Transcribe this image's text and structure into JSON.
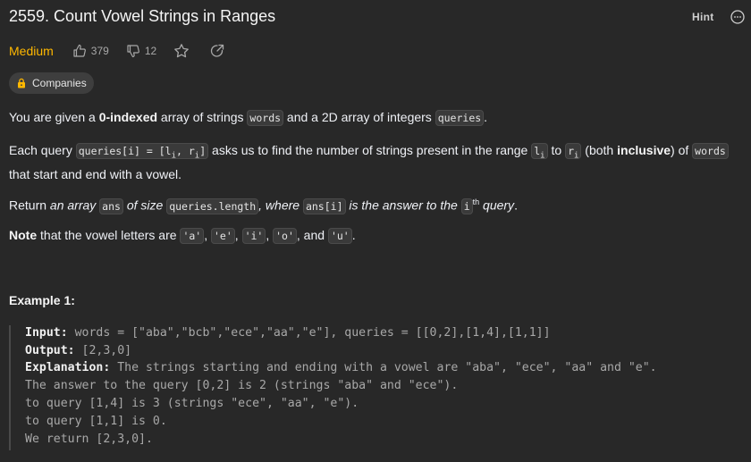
{
  "header": {
    "title": "2559. Count Vowel Strings in Ranges",
    "hint_label": "Hint",
    "more_icon": "more-circle-icon"
  },
  "meta": {
    "difficulty": "Medium",
    "difficulty_color": "#ffb800",
    "likes": "379",
    "dislikes": "12",
    "companies_label": "Companies"
  },
  "description": {
    "p1": {
      "t1": "You are given a ",
      "b1": "0-indexed",
      "t2": " array of strings ",
      "c1": "words",
      "t3": " and a 2D array of integers ",
      "c2": "queries",
      "t4": "."
    },
    "p2": {
      "t1": "Each query ",
      "c1a": "queries[i] = [l",
      "c1s1": "i",
      "c1b": ", r",
      "c1s2": "i",
      "c1c": "]",
      "t2": " asks us to find the number of strings present in the range ",
      "c2a": "l",
      "c2s": "i",
      "t3": " to ",
      "c3a": "r",
      "c3s": "i",
      "t4": " (both ",
      "b1": "inclusive",
      "t5": ") of ",
      "c4": "words",
      "line2": "that start and end with a vowel."
    },
    "p3": {
      "t1": "Return ",
      "i1": "an array ",
      "c1": "ans",
      "i2": " of size ",
      "c2": "queries.length",
      "i3": ", where ",
      "c3": "ans[i]",
      "i4": " is the answer to the ",
      "c4": "i",
      "sup": "th",
      "i5": " query",
      "t2": "."
    },
    "p4": {
      "b1": "Note",
      "t1": " that the vowel letters are ",
      "c1": "'a'",
      "t2": ", ",
      "c2": "'e'",
      "t3": ", ",
      "c3": "'i'",
      "t4": ", ",
      "c4": "'o'",
      "t5": ", and ",
      "c5": "'u'",
      "t6": "."
    }
  },
  "example1": {
    "title": "Example 1:",
    "input_label": "Input:",
    "input_value": " words = [\"aba\",\"bcb\",\"ece\",\"aa\",\"e\"], queries = [[0,2],[1,4],[1,1]]",
    "output_label": "Output:",
    "output_value": " [2,3,0]",
    "explanation_label": "Explanation:",
    "explanation_value": " The strings starting and ending with a vowel are \"aba\", \"ece\", \"aa\" and \"e\".",
    "line4": "The answer to the query [0,2] is 2 (strings \"aba\" and \"ece\").",
    "line5": "to query [1,4] is 3 (strings \"ece\", \"aa\", \"e\").",
    "line6": "to query [1,1] is 0.",
    "line7": "We return [2,3,0]."
  }
}
